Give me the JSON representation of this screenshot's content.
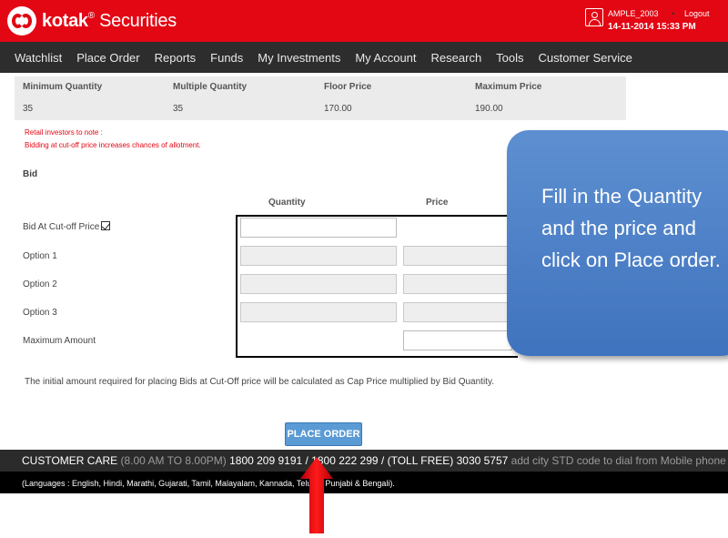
{
  "header": {
    "brand_main": "kotak",
    "brand_reg": "®",
    "brand_sub": "Securities",
    "username": "AMPLE_2003",
    "separator": "•",
    "logout_label": "Logout",
    "datetime": "14-11-2014 15:33 PM",
    "bg_color": "#e30613"
  },
  "nav": {
    "items": [
      "Watchlist",
      "Place Order",
      "Reports",
      "Funds",
      "My Investments",
      "My Account",
      "Research",
      "Tools",
      "Customer Service"
    ]
  },
  "info": {
    "headers": [
      "Minimum Quantity",
      "Multiple Quantity",
      "Floor Price",
      "Maximum Price"
    ],
    "values": [
      "35",
      "35",
      "170.00",
      "190.00"
    ]
  },
  "notice": {
    "line1": "Retail investors to note :",
    "line2": "Bidding at cut-off price increases chances of allotment."
  },
  "bid": {
    "title": "Bid",
    "col_quantity": "Quantity",
    "col_price": "Price",
    "rows": [
      "Bid At Cut-off Price",
      "Option 1",
      "Option 2",
      "Option 3",
      "Maximum Amount"
    ],
    "cutoff_checked": true
  },
  "calc_note": "The initial amount required for placing Bids at Cut-Off price will be calculated as Cap Price multiplied by Bid Quantity.",
  "place_order_label": "PLACE ORDER",
  "footer": {
    "care_label": "CUSTOMER CARE",
    "care_hours": "(8.00 AM TO 8.00PM)",
    "care_numbers": "1800 209 9191 / 1800 222 299 / (TOLL FREE) 3030 5757",
    "care_hint": "add city STD code to dial from Mobile phone",
    "languages": "(Languages : English, Hindi, Marathi, Gujarati, Tamil, Malayalam, Kannada, Telugu, Punjabi & Bengali)."
  },
  "callout": {
    "text": "Fill in the Quantity and the price and click on Place order.",
    "color": "#4f83c8"
  },
  "arrow": {
    "color": "#e30613"
  }
}
